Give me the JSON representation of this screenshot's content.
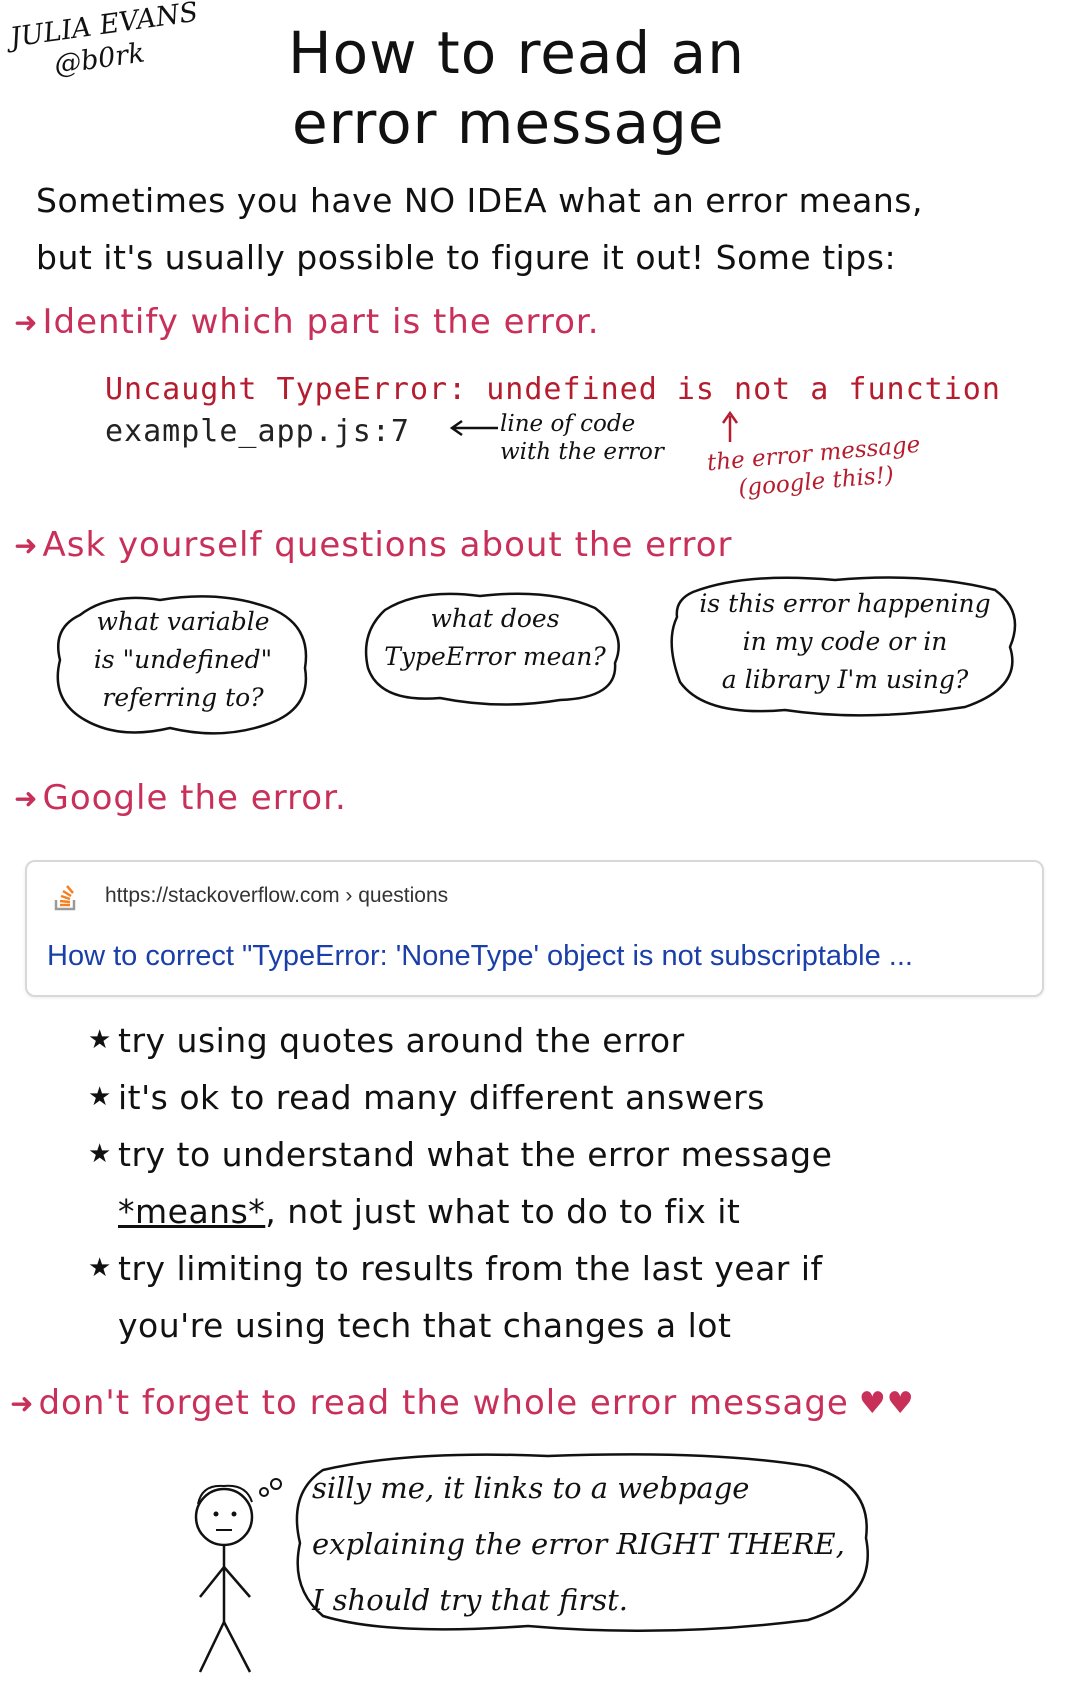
{
  "author": {
    "name": "JULIA EVANS",
    "handle": "@b0rk"
  },
  "title": {
    "line1": "How to read an",
    "line2": "error message"
  },
  "intro": {
    "line1": "Sometimes you have NO IDEA what an error means,",
    "line2": "but it's usually possible to figure it out! Some tips:"
  },
  "tips": {
    "identify": "Identify which part is the error.",
    "ask": "Ask yourself questions about the error",
    "google": "Google the error.",
    "read_whole": "don't forget to read the whole error message"
  },
  "code": {
    "error_line": "Uncaught TypeError: undefined is not a function",
    "file_line": "example_app.js:7"
  },
  "annotations": {
    "line_of_code": {
      "line1": "line of code",
      "line2": "with the error"
    },
    "error_message": {
      "line1": "the error message",
      "line2": "(google this!)"
    }
  },
  "questions": {
    "q1": {
      "line1": "what variable",
      "line2": "is \"undefined\"",
      "line3": "referring to?"
    },
    "q2": {
      "line1": "what does",
      "line2": "TypeError mean?"
    },
    "q3": {
      "line1": "is this error happening",
      "line2": "in my code or in",
      "line3": "a library I'm using?"
    }
  },
  "search_result": {
    "url": "https://stackoverflow.com › questions",
    "link_text": "How to correct \"TypeError: 'NoneType' object is not subscriptable ..."
  },
  "google_tips": {
    "t1": "try using quotes around the error",
    "t2": "it's ok to read many different answers",
    "t3_line1": "try to understand what the error message",
    "t3_means": "*means*",
    "t3_rest": ", not just what to do to fix it",
    "t4_line1": "try limiting to results from the last year if",
    "t4_line2": "you're using tech that changes a lot"
  },
  "thought": {
    "line1": "silly me, it links to a webpage",
    "line2": "explaining the error RIGHT THERE,",
    "line3": "I should try that first."
  },
  "colors": {
    "accent": "#c8305a",
    "error_red": "#b51d2e",
    "link_blue": "#1a3fa8"
  },
  "icons": [
    "right-arrow-icon",
    "up-arrow-icon",
    "left-arrow-icon",
    "stackoverflow-icon",
    "star-bullet-icon",
    "heart-icon",
    "stick-figure-icon"
  ]
}
